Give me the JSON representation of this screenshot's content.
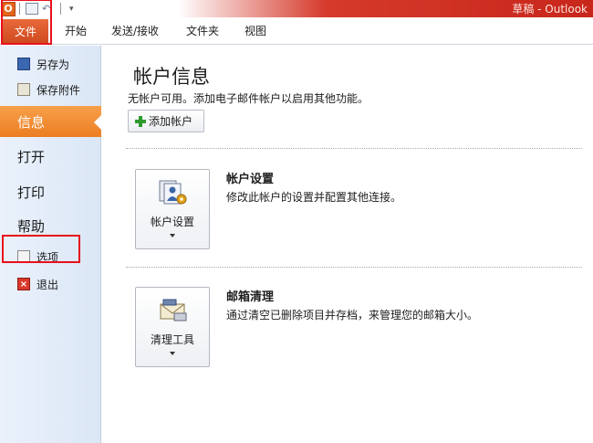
{
  "window": {
    "title": "草稿 - Outlook"
  },
  "quick_access": {
    "logo_letter": "O",
    "icons": [
      "outlook-logo-icon",
      "save-icon",
      "undo-icon",
      "customize-arrow-icon"
    ]
  },
  "ribbon": {
    "file_tab": "文件",
    "tabs": [
      "开始",
      "发送/接收",
      "文件夹",
      "视图"
    ]
  },
  "sidebar": {
    "save_as": "另存为",
    "save_attachments": "保存附件",
    "info": "信息",
    "open": "打开",
    "print": "打印",
    "help": "帮助",
    "options": "选项",
    "exit": "退出"
  },
  "main": {
    "title": "帐户信息",
    "subtitle": "无帐户可用。添加电子邮件帐户以启用其他功能。",
    "add_account": "添加帐户",
    "account_settings": {
      "button_label": "帐户设置",
      "title": "帐户设置",
      "description": "修改此帐户的设置并配置其他连接。"
    },
    "cleanup": {
      "button_label": "清理工具",
      "title": "邮箱清理",
      "description": "通过清空已删除项目并存档，来管理您的邮箱大小。"
    }
  },
  "colors": {
    "accent_orange": "#ec7d22",
    "file_tab": "#d9522c",
    "title_bar_red": "#c8261a",
    "highlight_box": "#e8101c"
  }
}
